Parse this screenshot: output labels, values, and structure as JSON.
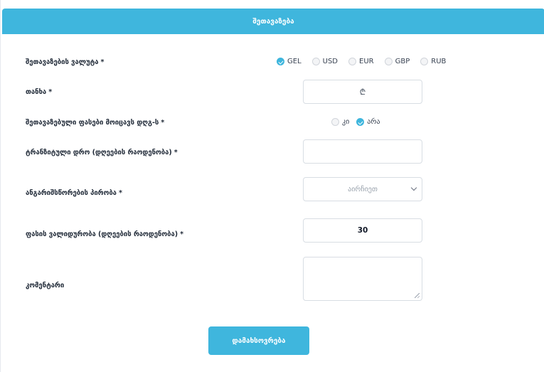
{
  "header": {
    "title": "შეთავაზება"
  },
  "form": {
    "currency": {
      "label": "შეთავაზების ვალუტა",
      "required": "*",
      "options": [
        "GEL",
        "USD",
        "EUR",
        "GBP",
        "RUB"
      ],
      "selected": "GEL"
    },
    "amount": {
      "label": "თანხა",
      "required": "*",
      "value": "₾"
    },
    "vat": {
      "label": "შეთავაზებული ფასები მოიცავს დღგ-ს",
      "required": "*",
      "options": [
        "კი",
        "არა"
      ],
      "selected": "არა"
    },
    "transit_time": {
      "label": "ტრანზიტული დრო (დღეების რაოდენობა)",
      "required": "*",
      "value": ""
    },
    "payment_terms": {
      "label": "ანგარიშსწორების პირობა",
      "required": "*",
      "selected_value": "აირჩიეთ"
    },
    "price_validity": {
      "label": "ფასის ვალიდურობა (დღეების რაოდენობა)",
      "required": "*",
      "value": "30"
    },
    "comment": {
      "label": "კომენტარი",
      "value": ""
    },
    "save_label": "დამახსოვრება"
  },
  "colors": {
    "accent": "#3fb6dd",
    "border": "#d8dde3"
  }
}
